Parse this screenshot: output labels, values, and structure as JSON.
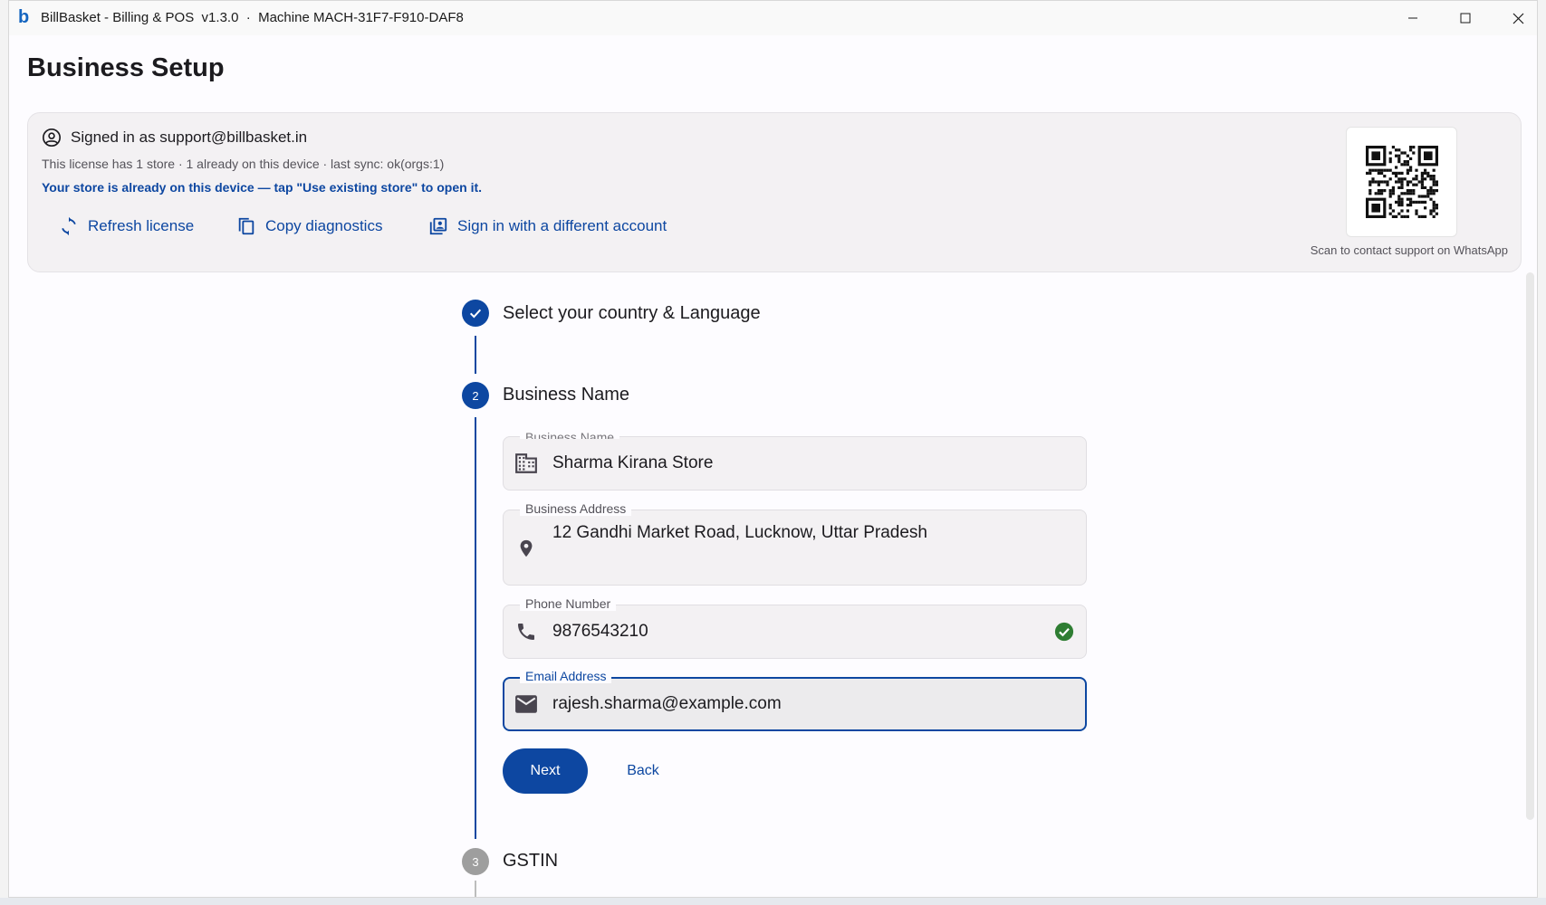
{
  "window": {
    "app_title": "BillBasket - Billing & POS  v1.3.0  ·  Machine MACH-31F7-F910-DAF8",
    "logo_letter": "b"
  },
  "page": {
    "title": "Business Setup"
  },
  "license": {
    "signed_in_text": "Signed in as support@billbasket.in",
    "info": "This license has 1 store · 1 already on this device · last sync: ok(orgs:1)",
    "notice": "Your store is already on this device — tap \"Use existing store\" to open it.",
    "actions": {
      "refresh": "Refresh license",
      "copy": "Copy diagnostics",
      "switch": "Sign in with a different account"
    },
    "qr_caption": "Scan to contact support on WhatsApp"
  },
  "stepper": {
    "steps": [
      {
        "label": "Select your country & Language",
        "state": "done"
      },
      {
        "label": "Business Name",
        "number": "2",
        "state": "active"
      },
      {
        "label": "GSTIN",
        "number": "3",
        "state": "pending"
      }
    ]
  },
  "form": {
    "business_name": {
      "label": "Business Name",
      "value": "Sharma Kirana Store",
      "icon": "building-icon"
    },
    "business_address": {
      "label": "Business Address",
      "value": "12 Gandhi Market Road, Lucknow, Uttar Pradesh",
      "icon": "location-pin-icon"
    },
    "phone": {
      "label": "Phone Number",
      "value": "9876543210",
      "icon": "phone-icon",
      "valid": true
    },
    "email": {
      "label": "Email Address",
      "value": "rajesh.sharma@example.com",
      "icon": "mail-icon",
      "focused": true
    },
    "next_label": "Next",
    "back_label": "Back"
  },
  "colors": {
    "primary": "#0d47a1",
    "success": "#2e7d32",
    "surface": "#f3f1f3",
    "inactive_step": "#9e9e9e"
  }
}
